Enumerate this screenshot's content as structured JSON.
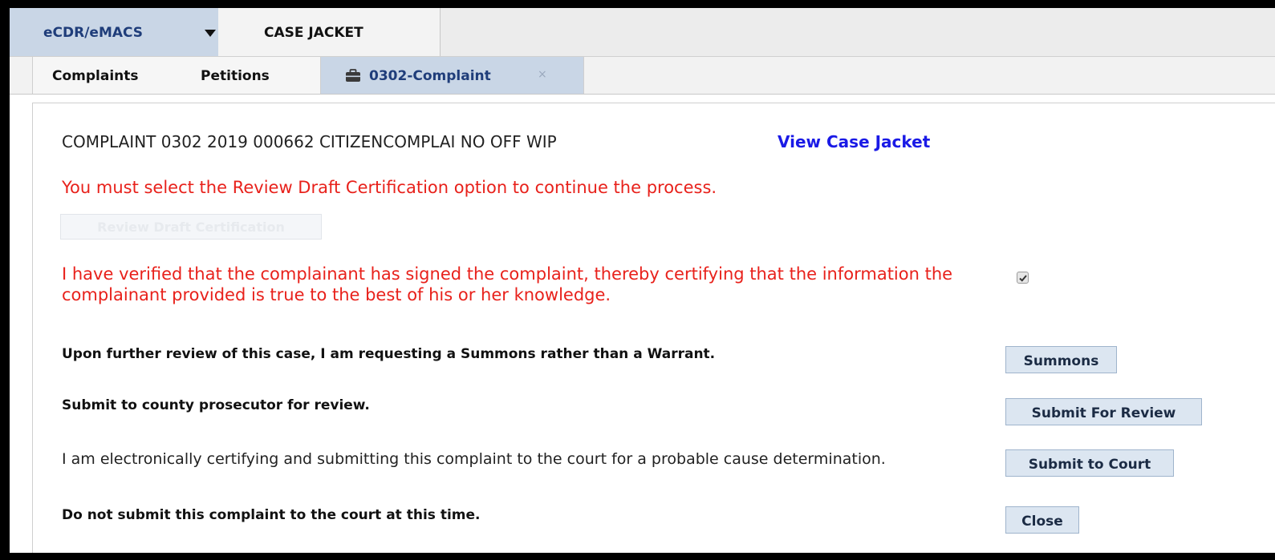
{
  "topnav": {
    "app_label": "eCDR/eMACS",
    "case_tab_label": "CASE JACKET"
  },
  "subnav": {
    "tabs": [
      {
        "label": "Complaints"
      },
      {
        "label": "Petitions"
      },
      {
        "label": "0302-Complaint",
        "close": "×"
      }
    ]
  },
  "main": {
    "heading": "COMPLAINT 0302 2019 000662 CITIZENCOMPLAI NO OFF WIP",
    "view_case_jacket": "View Case Jacket",
    "warning": "You must select the Review Draft Certification option to continue the process.",
    "review_button": "Review Draft Certification",
    "verify_text": "I have verified that the complainant has signed the complaint, thereby certifying that the information the complainant provided is true to the best of his or her knowledge.",
    "verify_checked": true,
    "summons_text": "Upon further review of this case, I am requesting a Summons rather than a Warrant.",
    "summons_button": "Summons",
    "review_text": "Submit to county prosecutor for review.",
    "review_submit_button": "Submit For Review",
    "court_text": "I am electronically certifying and submitting this complaint to the court for a probable cause determination.",
    "court_button": "Submit to Court",
    "close_text": "Do not submit this complaint to the court at this time.",
    "close_button": "Close"
  },
  "colors": {
    "accent": "#1f3d7a",
    "active_tab": "#c9d6e6",
    "warning": "#e8211b",
    "link": "#1a1ae6",
    "button": "#dce6f1"
  },
  "icons": {
    "app_menu": "caret-down-icon",
    "case_tab": "briefcase-icon",
    "close_tab": "close-icon",
    "verify": "checkmark-icon"
  }
}
